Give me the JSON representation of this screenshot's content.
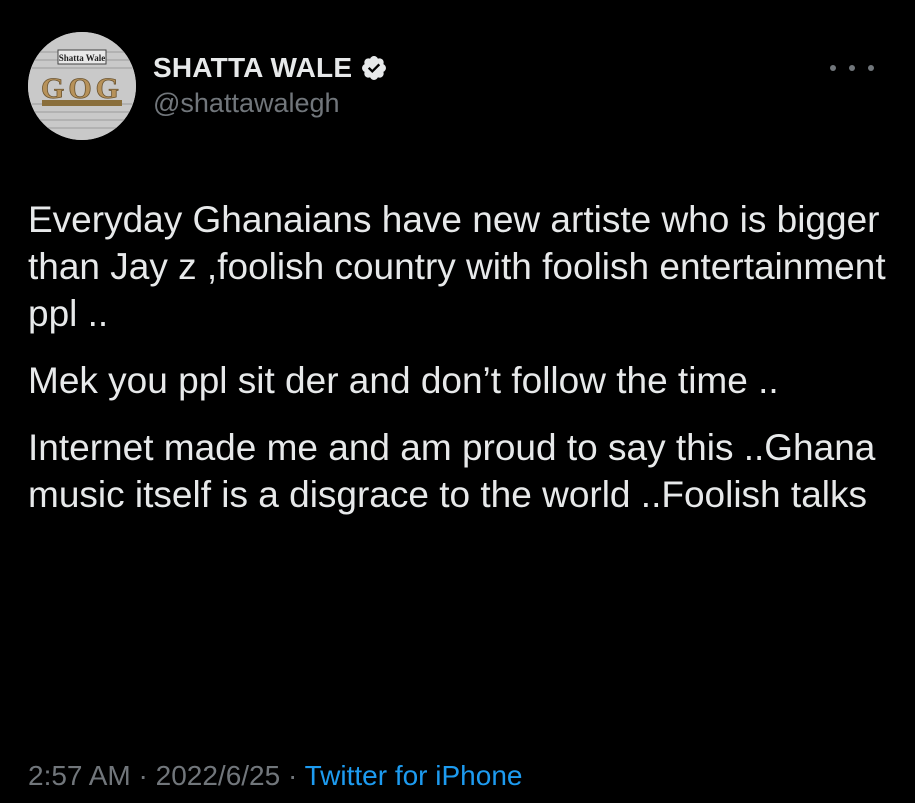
{
  "author": {
    "name": "SHATTA WALE",
    "handle": "@shattawalegh",
    "verified_icon": "verified-badge-icon",
    "avatar_text_top": "Shatta Wale",
    "avatar_text_mid": "GOG"
  },
  "tweet": {
    "paragraphs": [
      "Everyday Ghanaians have new artiste who is bigger than Jay z ,foolish country with foolish entertainment ppl ..",
      "Mek you ppl sit der and don’t follow the time ..",
      "Internet made me and am proud to say this ..Ghana music itself is a disgrace to the world ..Foolish talks"
    ]
  },
  "meta": {
    "time": "2:57 AM",
    "sep1": " · ",
    "date": "2022/6/25",
    "sep2": " · ",
    "source": "Twitter for iPhone"
  },
  "colors": {
    "background": "#000000",
    "text": "#e7e9ea",
    "secondary": "#71767b",
    "link": "#1d9bf0"
  }
}
